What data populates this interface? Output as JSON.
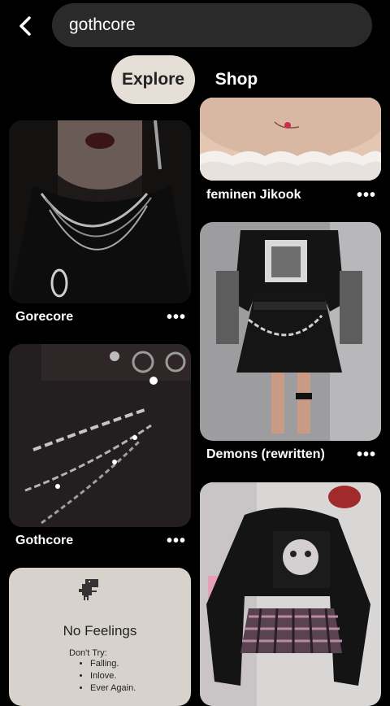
{
  "header": {
    "back_icon": "chevron-left-icon",
    "search_value": "gothcore"
  },
  "tabs": [
    {
      "label": "Explore",
      "active": true
    },
    {
      "label": "Shop",
      "active": false
    }
  ],
  "pins": [
    {
      "title": "Gorecore",
      "menu": "•••"
    },
    {
      "title": "Gothcore",
      "menu": "•••"
    },
    {
      "title": "feminen Jikook",
      "menu": "•••"
    },
    {
      "title": "Demons (rewritten)",
      "menu": "•••"
    }
  ],
  "no_feelings_pin": {
    "title": "No Feelings",
    "subtitle": "Don't Try:",
    "items": [
      "Falling.",
      "Inlove.",
      "Ever Again."
    ]
  },
  "colors": {
    "background": "#000000",
    "search_bg": "#2a2a2a",
    "active_tab_bg": "#e6dfd8"
  }
}
